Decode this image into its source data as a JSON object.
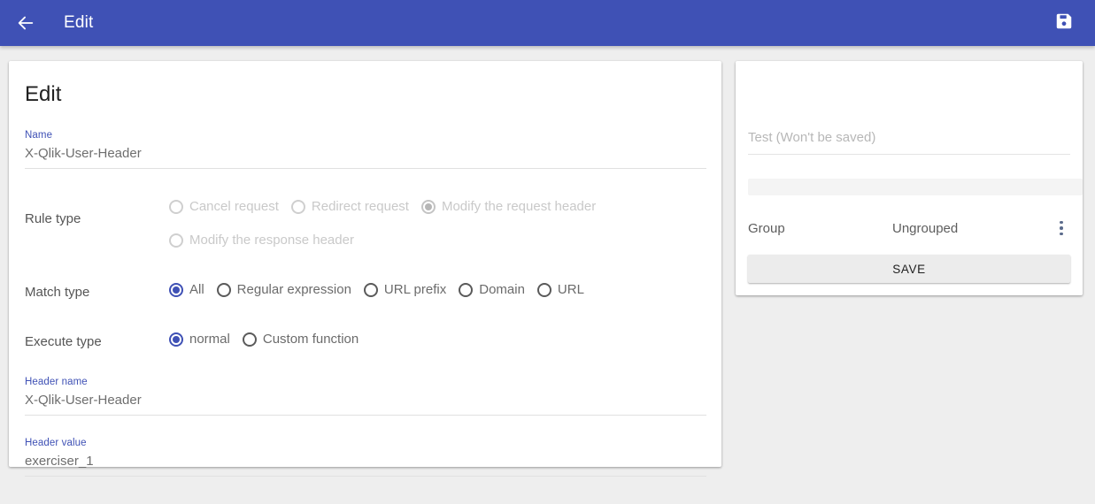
{
  "toolbar": {
    "back_icon": "arrow-left-icon",
    "title": "Edit",
    "save_icon": "floppy-disk-save-icon"
  },
  "colors": {
    "primary": "#3f51b5",
    "page_background": "#eeeeee",
    "card_background": "#ffffff",
    "label_blue": "#3f51b5",
    "disabled_text": "#c9c9c9",
    "body_text": "#6b6b6b",
    "save_button_background": "#ececec"
  },
  "left_card": {
    "title": "Edit",
    "name_field": {
      "label": "Name",
      "value": "X-Qlik-User-Header"
    },
    "rule_type": {
      "label": "Rule type",
      "disabled": true,
      "options": [
        {
          "label": "Cancel request",
          "selected": false
        },
        {
          "label": "Redirect request",
          "selected": false
        },
        {
          "label": "Modify the request header",
          "selected": true
        },
        {
          "label": "Modify the response header",
          "selected": false
        }
      ]
    },
    "match_type": {
      "label": "Match type",
      "disabled": false,
      "options": [
        {
          "label": "All",
          "selected": true
        },
        {
          "label": "Regular expression",
          "selected": false
        },
        {
          "label": "URL prefix",
          "selected": false
        },
        {
          "label": "Domain",
          "selected": false
        },
        {
          "label": "URL",
          "selected": false
        }
      ]
    },
    "execute_type": {
      "label": "Execute type",
      "disabled": false,
      "options": [
        {
          "label": "normal",
          "selected": true
        },
        {
          "label": "Custom function",
          "selected": false
        }
      ]
    },
    "header_name_field": {
      "label": "Header name",
      "value": "X-Qlik-User-Header"
    },
    "header_value_field": {
      "label": "Header value",
      "value": "exerciser_1"
    }
  },
  "right_card": {
    "test_input": {
      "value": "",
      "placeholder": "Test (Won't be saved)"
    },
    "group_row": {
      "label": "Group",
      "value": "Ungrouped",
      "menu_icon": "more-vertical-icon"
    },
    "save_button": {
      "label": "SAVE"
    }
  }
}
